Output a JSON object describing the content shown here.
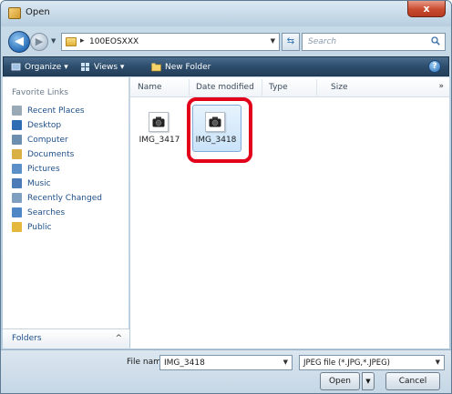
{
  "window": {
    "title": "Open",
    "close_symbol": "x"
  },
  "address": {
    "path": "100EOSXXX",
    "separator": "▸",
    "search_placeholder": "Search"
  },
  "toolbar": {
    "organize_label": "Organize",
    "views_label": "Views",
    "new_folder_label": "New Folder",
    "help_label": "?"
  },
  "nav": {
    "heading": "Favorite Links",
    "items": [
      {
        "label": "Recent Places",
        "icon": "recent-places-icon",
        "color": "#9aa9b6"
      },
      {
        "label": "Desktop",
        "icon": "desktop-icon",
        "color": "#2e6db4"
      },
      {
        "label": "Computer",
        "icon": "computer-icon",
        "color": "#6c8fb0"
      },
      {
        "label": "Documents",
        "icon": "documents-icon",
        "color": "#d9b043"
      },
      {
        "label": "Pictures",
        "icon": "pictures-icon",
        "color": "#5a8fc7"
      },
      {
        "label": "Music",
        "icon": "music-icon",
        "color": "#4c7bb8"
      },
      {
        "label": "Recently Changed",
        "icon": "recently-changed-icon",
        "color": "#7f9fc0"
      },
      {
        "label": "Searches",
        "icon": "searches-icon",
        "color": "#4f86c6"
      },
      {
        "label": "Public",
        "icon": "public-folder-icon",
        "color": "#e3b83c"
      }
    ],
    "folders_label": "Folders",
    "folders_chevron": "^"
  },
  "columns": {
    "name": "Name",
    "date_modified": "Date modified",
    "type": "Type",
    "size": "Size",
    "more": "»"
  },
  "files": [
    {
      "name": "IMG_3417",
      "selected": false
    },
    {
      "name": "IMG_3418",
      "selected": true
    }
  ],
  "bottom": {
    "file_name_label": "File name:",
    "file_name_value": "IMG_3418",
    "file_type_value": "JPEG file (*.JPG,*.JPEG)",
    "open_label": "Open",
    "cancel_label": "Cancel"
  },
  "colors": {
    "highlight": "#e3001b",
    "toolbar": "#2d4d6c",
    "link": "#1f4f8a"
  }
}
